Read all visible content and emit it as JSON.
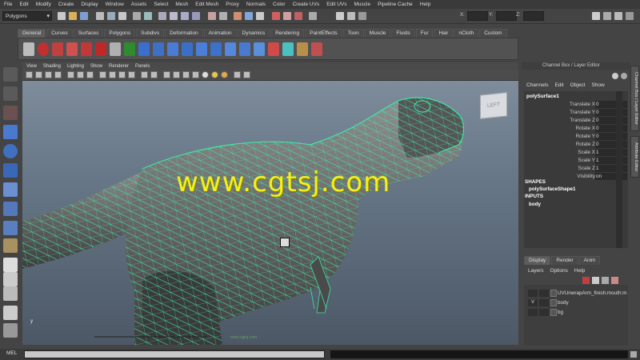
{
  "menubar": {
    "items": [
      "File",
      "Edit",
      "Modify",
      "Create",
      "Display",
      "Window",
      "Assets",
      "Select",
      "Mesh",
      "Edit Mesh",
      "Proxy",
      "Normals",
      "Color",
      "Create UVs",
      "Edit UVs",
      "Muscle",
      "Pipeline Cache",
      "Help"
    ]
  },
  "statusline": {
    "mode": "Polygons",
    "x_label": "X:",
    "y_label": "Y:",
    "z_label": "Z:"
  },
  "shelf": {
    "tabs": [
      "General",
      "Curves",
      "Surfaces",
      "Polygons",
      "Subdivs",
      "Deformation",
      "Animation",
      "Dynamics",
      "Rendering",
      "PaintEffects",
      "Toon",
      "Muscle",
      "Fluids",
      "Fur",
      "Hair",
      "nCloth",
      "Custom"
    ],
    "active_tab": "General"
  },
  "viewport": {
    "menu": [
      "View",
      "Shading",
      "Lighting",
      "Show",
      "Renderer",
      "Panels"
    ],
    "viewcube_label": "LEFT",
    "watermark": "www.cgtsj.com",
    "axis_label": "y",
    "credit": "www.cgtsj.com"
  },
  "channelbox": {
    "header": "Channel Box / Layer Editor",
    "menu": [
      "Channels",
      "Edit",
      "Object",
      "Show"
    ],
    "object_name": "polySurface1",
    "attributes": [
      {
        "label": "Translate X",
        "value": "0"
      },
      {
        "label": "Translate Y",
        "value": "0"
      },
      {
        "label": "Translate Z",
        "value": "0"
      },
      {
        "label": "Rotate X",
        "value": "0"
      },
      {
        "label": "Rotate Y",
        "value": "0"
      },
      {
        "label": "Rotate Z",
        "value": "0"
      },
      {
        "label": "Scale X",
        "value": "1"
      },
      {
        "label": "Scale Y",
        "value": "1"
      },
      {
        "label": "Scale Z",
        "value": "1"
      },
      {
        "label": "Visibility",
        "value": "on"
      }
    ],
    "shapes_head": "SHAPES",
    "shape_item": "polySurfaceShape1",
    "inputs_head": "INPUTS",
    "input_item": "body"
  },
  "side_tabs": [
    "Channel Box / Layer Editor",
    "Attribute Editor"
  ],
  "layer_editor": {
    "tabs": [
      "Display",
      "Render",
      "Anim"
    ],
    "active_tab": "Display",
    "menu": [
      "Layers",
      "Options",
      "Help"
    ],
    "layers": [
      {
        "visible": "",
        "name": "UVUnwrapArm_finish:mouth:m"
      },
      {
        "visible": "V",
        "name": "body"
      },
      {
        "visible": "",
        "name": "bg"
      }
    ]
  },
  "bottom": {
    "mel_label": "MEL"
  },
  "colors": {
    "wireframe": "#3fe6a8",
    "watermark": "#f4f01c",
    "viewport_top": "#7e8c9b",
    "viewport_bottom": "#4c5866"
  }
}
